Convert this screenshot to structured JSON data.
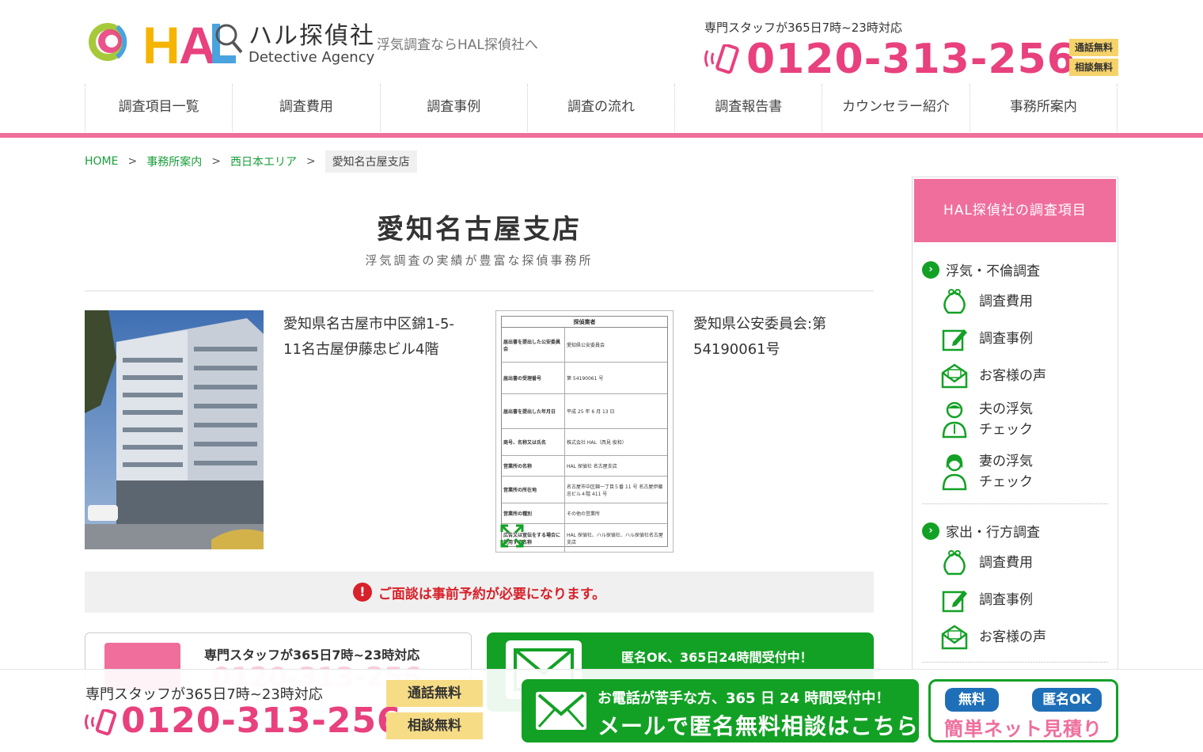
{
  "brand": {
    "name_jp": "ハル探偵社",
    "name_en": "Detective Agency",
    "tagline": "浮気調査ならHAL探偵社へ"
  },
  "header_contact": {
    "staff_hours": "専門スタッフが365日7時~23時対応",
    "phone": "0120-313-256",
    "badge_call": "通話無料",
    "badge_consult": "相談無料"
  },
  "nav": {
    "items": [
      "調査項目一覧",
      "調査費用",
      "調査事例",
      "調査の流れ",
      "調査報告書",
      "カウンセラー紹介",
      "事務所案内"
    ]
  },
  "breadcrumb": {
    "home": "HOME",
    "sep": ">",
    "offices": "事務所案内",
    "area": "西日本エリア",
    "current": "愛知名古屋支店"
  },
  "main": {
    "title": "愛知名古屋支店",
    "subtitle": "浮気調査の実績が豊富な探偵事務所",
    "address": "愛知県名古屋市中区錦1-5-11名古屋伊藤忠ビル4階",
    "license_no": "愛知県公安委員会:第54190061号",
    "notice": "ご面談は事前予約が必要になります。",
    "tel_card_text": "専門スタッフが365日7時~23時対応",
    "tel_card_phone": "0120-313-256",
    "mail_card_text": "匿名OK、365日24時間受付中！"
  },
  "license_doc": {
    "title": "探偵業者",
    "rows": [
      {
        "k": "届出書を提出した公安委員会",
        "v": "愛知県公安委員会"
      },
      {
        "k": "届出書の受理番号",
        "v": "第 54190061 号"
      },
      {
        "k": "届出書を提出した年月日",
        "v": "平成 25 年 6 月 13 日"
      },
      {
        "k": "商号、名称又は氏名",
        "v": "株式会社 HAL（西見 俊和）"
      },
      {
        "k": "営業所の名称",
        "v": "HAL 探偵社 名古屋支店"
      },
      {
        "k": "営業所の所在地",
        "v": "名古屋市中区錦一丁目５番 11 号 名古屋伊藤忠ビル４階 411 号"
      },
      {
        "k": "営業所の種別",
        "v": "その他の営業所"
      },
      {
        "k": "広告又は宣伝をする場合に使用する名称",
        "v": "HAL 探偵社、ハル探偵社、ハル探偵社名古屋支店"
      }
    ]
  },
  "sidebar": {
    "header": "HAL探偵社の調査項目",
    "cat1": "浮気・不倫調査",
    "cat1_items": [
      "調査費用",
      "調査事例",
      "お客様の声",
      "夫の浮気チェック",
      "妻の浮気チェック"
    ],
    "cat2": "家出・行方調査",
    "cat2_items": [
      "調査費用",
      "調査事例",
      "お客様の声"
    ]
  },
  "sticky": {
    "staff_hours": "専門スタッフが365日7時~23時対応",
    "phone": "0120-313-256",
    "badge_call": "通話無料",
    "badge_consult": "相談無料",
    "mail_line1": "お電話が苦手な方、365 日 24 時間受付中！",
    "mail_line2": "メールで匿名無料相談はこちら",
    "quote_badge1": "無料",
    "quote_badge2": "匿名OK",
    "quote_text": "簡単ネット見積り"
  },
  "colors": {
    "brand_pink": "#ef6e9c",
    "phone_pink": "#e8417e",
    "green": "#13a125",
    "alert_red": "#d8212a",
    "badge_yellow": "#f5d36a"
  }
}
